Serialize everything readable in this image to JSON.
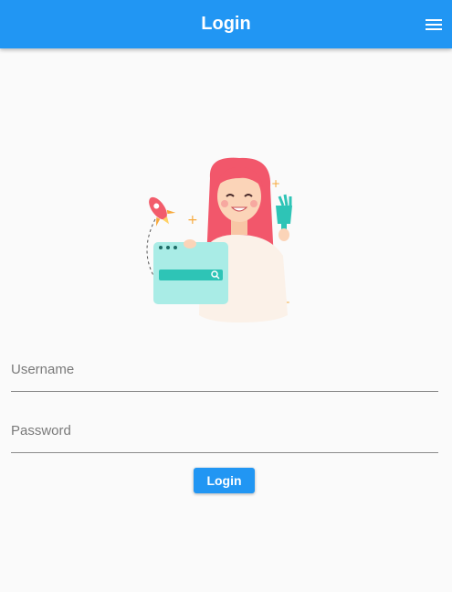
{
  "appbar": {
    "title": "Login",
    "menu_icon": "menu-icon",
    "color": "#2196f3"
  },
  "illustration": {
    "icon": "girl-with-browser-illustration"
  },
  "form": {
    "username_placeholder": "Username",
    "username_value": "",
    "password_placeholder": "Password",
    "password_value": "",
    "login_label": "Login"
  }
}
